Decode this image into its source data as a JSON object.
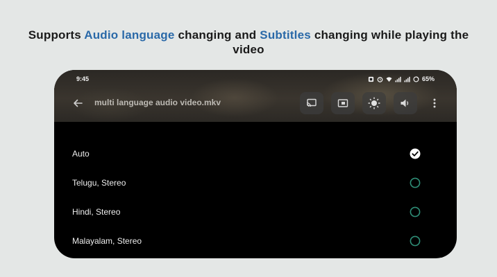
{
  "headline": {
    "part1": "Supports ",
    "highlight1": "Audio language",
    "part2": " changing and ",
    "highlight2": "Subtitles",
    "part3": " changing while playing the video"
  },
  "status_bar": {
    "time": "9:45",
    "battery": "65%",
    "icons": [
      "notification-icon",
      "alarm-icon",
      "wifi-icon",
      "signal-icon",
      "signal-icon",
      "battery-icon"
    ]
  },
  "toolbar": {
    "title": "multi language audio video.mkv",
    "icons": [
      "back-arrow-icon",
      "cast-icon",
      "picture-in-picture-icon",
      "brightness-icon",
      "volume-icon",
      "more-vert-icon"
    ]
  },
  "audio_tracks": [
    {
      "label": "Auto",
      "selected": true
    },
    {
      "label": "Telugu, Stereo",
      "selected": false
    },
    {
      "label": "Hindi, Stereo",
      "selected": false
    },
    {
      "label": "Malayalam, Stereo",
      "selected": false
    }
  ],
  "colors": {
    "background": "#e4e7e6",
    "highlight": "#2a69a8",
    "radio_accent": "#2f8f78"
  }
}
